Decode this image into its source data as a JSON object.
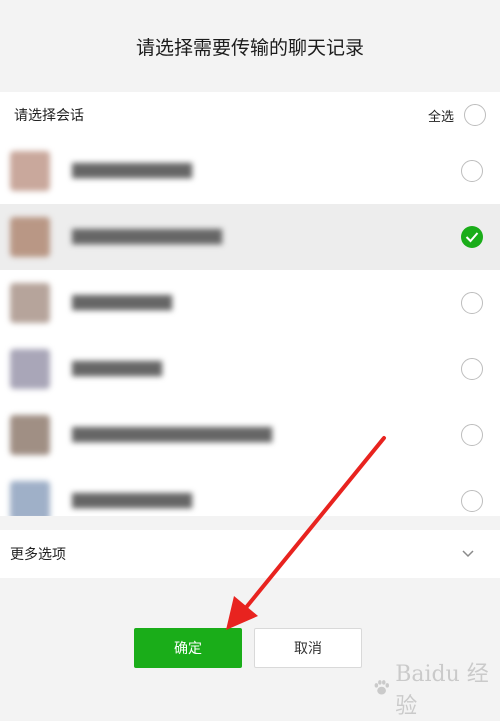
{
  "dialog": {
    "title": "请选择需要传输的聊天记录"
  },
  "header": {
    "label": "请选择会话",
    "select_all": "全选"
  },
  "conversations": [
    {
      "selected": false,
      "avatar_color": "#c9a89c"
    },
    {
      "selected": true,
      "avatar_color": "#b99785"
    },
    {
      "selected": false,
      "avatar_color": "#b6a49b"
    },
    {
      "selected": false,
      "avatar_color": "#a9a6b8"
    },
    {
      "selected": false,
      "avatar_color": "#a08f84"
    },
    {
      "selected": false,
      "avatar_color": "#9fb0c8"
    }
  ],
  "more_options": {
    "label": "更多选项"
  },
  "buttons": {
    "confirm": "确定",
    "cancel": "取消"
  },
  "watermark": {
    "text": "Baidu 经验"
  },
  "colors": {
    "accent": "#1aad19",
    "arrow": "#e8231f",
    "background": "#f3f3f3"
  }
}
